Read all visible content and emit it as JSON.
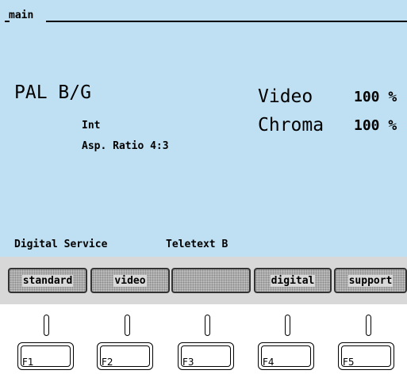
{
  "screen": {
    "title": "main",
    "standard": "PAL B/G",
    "source": "Int",
    "aspect_ratio": "Asp. Ratio 4:3",
    "video_label": "Video",
    "video_value": "100 %",
    "chroma_label": "Chroma",
    "chroma_value": "100 %",
    "digital_service": "Digital Service",
    "teletext": "Teletext B"
  },
  "softkeys": [
    "standard",
    "video",
    "",
    "digital",
    "support"
  ],
  "fkeys": [
    "F1",
    "F2",
    "F3",
    "F4",
    "F5"
  ]
}
